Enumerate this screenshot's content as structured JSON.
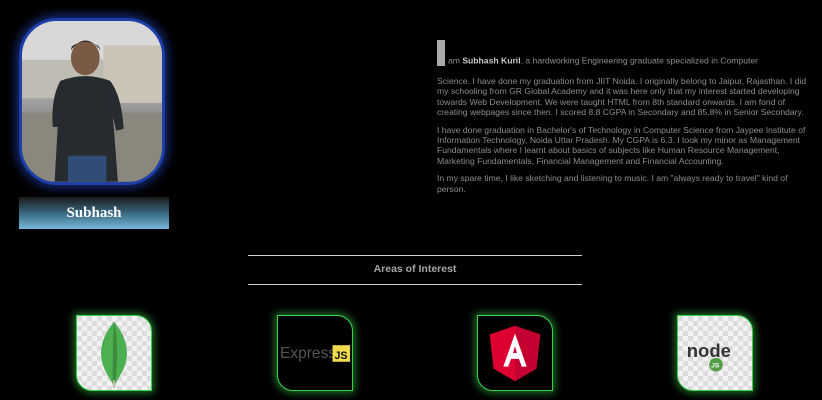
{
  "profile": {
    "name": "Subhash",
    "photo_icon": "profile-photo"
  },
  "bio": {
    "intro_prefix": "am ",
    "intro_name": "Subhash Kuril",
    "intro_suffix": ", a hardworking Engineering graduate specialized in Computer",
    "para1": "Science. I have done my graduation from JIIT Noida. I originally belong to Jaipur, Rajasthan. I did my schooling from GR Global Academy and it was here only that my interest started developing towards Web Development. We were taught HTML from 8th standard onwards. I am fond of creating webpages since then. I scored 8.8 CGPA in Secondary and 85.8% in Senior Secondary.",
    "para2": "I have done graduation in Bachelor's of Technology in Computer Science from Jaypee Institute of Information Technology, Noida Uttar Pradesh. My CGPA is 6.3. I took my minor as Management Fundamentals where I learnt about basics of subjects like Human Resource Management, Marketing Fundamentals, Financial Management and Financial Accounting.",
    "para3": "In my spare time, I like sketching and listening to music. I am \"always ready to travel\" kind of person."
  },
  "interests": {
    "title": "Areas of Interest",
    "items": [
      {
        "name": "MongoDB",
        "icon": "mongodb-leaf-icon"
      },
      {
        "name": "Express",
        "icon": "express-js-icon",
        "label": "Express",
        "badge": "JS"
      },
      {
        "name": "Angular",
        "icon": "angular-icon"
      },
      {
        "name": "Node.js",
        "icon": "nodejs-icon",
        "label": "node",
        "badge": "JS"
      }
    ]
  },
  "colors": {
    "background": "#000000",
    "photo_border": "#1f3fa8",
    "tile_glow": "#3ad04a",
    "angular_red": "#dd0031",
    "mongo_green": "#4caf50",
    "express_yellow": "#f0db4f",
    "node_green": "#539e43"
  }
}
